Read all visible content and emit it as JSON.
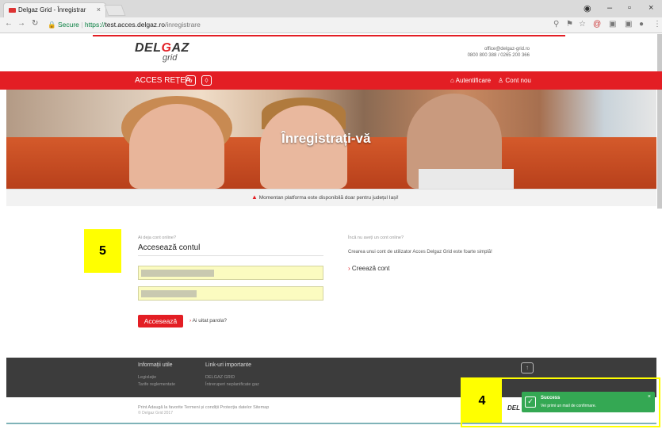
{
  "browser": {
    "tab_title": "Delgaz Grid - Înregistrar",
    "tab_close": "×",
    "url_secure_label": "Secure",
    "url_protocol": "https://",
    "url_host": "test.acces.delgaz.ro",
    "url_path": "/inregistrare"
  },
  "header": {
    "logo_main_1": "DEL",
    "logo_main_2": "G",
    "logo_main_3": "AZ",
    "logo_sub": "grid",
    "email": "office@delgaz-grid.ro",
    "phones": "0800 800 388 / 0265 200 366"
  },
  "nav": {
    "title": "ACCES REȚEA",
    "login": "Autentificare",
    "signup": "Cont nou"
  },
  "hero": {
    "title": "Înregistrați-vă"
  },
  "notice": {
    "text": "Momentan platforma este disponibilă doar pentru județul Iași!"
  },
  "annotations": {
    "box5": "5",
    "box4": "4"
  },
  "login": {
    "prompt": "Ai deja cont online?",
    "title": "Accesează contul",
    "submit": "Accesează",
    "forgot": "Ai uitat parola?"
  },
  "register": {
    "prompt": "Încă nu aveți un cont online?",
    "description": "Crearea unui cont de utilizator Acces Delgaz Grid este foarte simplă!",
    "link": "Creează cont"
  },
  "footer": {
    "col1_title": "Informații utile",
    "col1_links": [
      "Legislație",
      "Tarife reglementate"
    ],
    "col2_title": "Link-uri importante",
    "col2_links": [
      "DELGAZ GRID",
      "Întreruperi neplanificate gaz"
    ],
    "bottom_links": "Print   Adaugă la favorite   Termeni și condiții   Protecția datelor   Sitemap",
    "copyright": "© Delgaz Grid 2017"
  },
  "toast": {
    "title": "Success",
    "message": "Vei primi un mail de confirmare.",
    "close": "×"
  },
  "colors": {
    "brand_red": "#e31e24",
    "success_green": "#34a853",
    "highlight_yellow": "#ffff00"
  }
}
